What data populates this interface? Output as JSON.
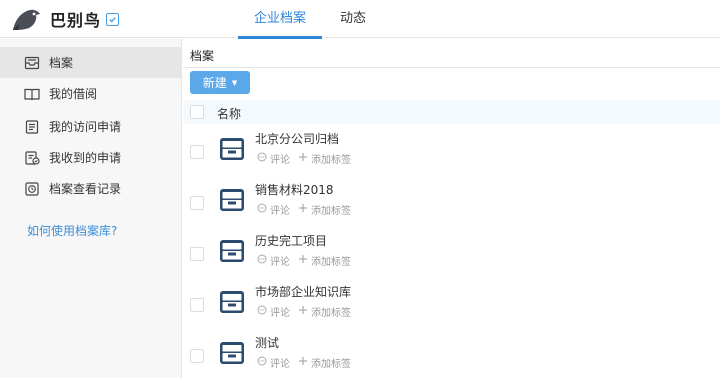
{
  "header": {
    "app_name": "巴别鸟",
    "tabs": [
      {
        "label": "企业档案",
        "active": true
      },
      {
        "label": "动态",
        "active": false
      }
    ]
  },
  "sidebar": {
    "items": [
      {
        "label": "档案",
        "icon": "archive-box-icon",
        "active": true
      },
      {
        "label": "我的借阅",
        "icon": "open-book-icon",
        "active": false
      },
      {
        "label": "我的访问申请",
        "icon": "document-list-icon",
        "active": false
      },
      {
        "label": "我收到的申请",
        "icon": "document-check-icon",
        "active": false
      },
      {
        "label": "档案查看记录",
        "icon": "clock-history-icon",
        "active": false
      }
    ],
    "help_link": "如何使用档案库?"
  },
  "main": {
    "breadcrumb": "档案",
    "new_button": "新建",
    "column_name": "名称",
    "rows": [
      {
        "title": "北京分公司归档",
        "comment": "评论",
        "add_tag": "添加标签"
      },
      {
        "title": "销售材料2018",
        "comment": "评论",
        "add_tag": "添加标签"
      },
      {
        "title": "历史完工项目",
        "comment": "评论",
        "add_tag": "添加标签"
      },
      {
        "title": "市场部企业知识库",
        "comment": "评论",
        "add_tag": "添加标签"
      },
      {
        "title": "测试",
        "comment": "评论",
        "add_tag": "添加标签"
      }
    ]
  },
  "colors": {
    "accent": "#2f86db",
    "button": "#5aa7ea",
    "archive_icon": "#2a4a6e",
    "link": "#3a8fd9"
  }
}
